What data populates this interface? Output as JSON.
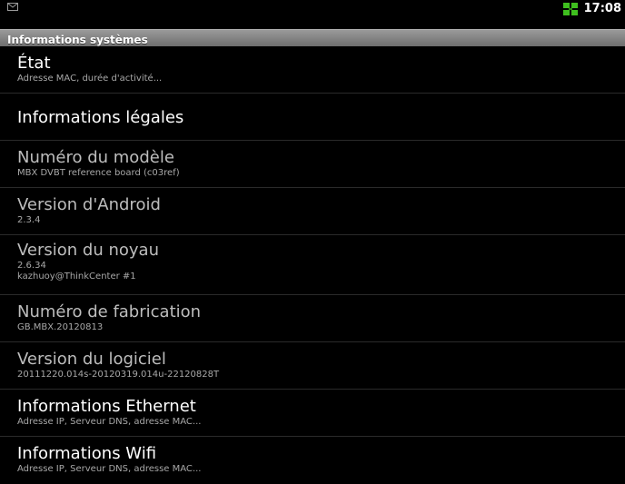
{
  "statusbar": {
    "notification_icon": "mail-icon",
    "network_icon": "network-icon",
    "time": "17:08"
  },
  "title": "Informations systèmes",
  "items": [
    {
      "title": "État",
      "summary": "Adresse MAC, durée d'activité..."
    },
    {
      "title": "Informations légales"
    },
    {
      "title": "Numéro du modèle",
      "summary": "MBX DVBT reference board (c03ref)"
    },
    {
      "title": "Version d'Android",
      "summary": "2.3.4"
    },
    {
      "title": "Version du noyau",
      "summary": "2.6.34",
      "summary2": "kazhuoy@ThinkCenter #1"
    },
    {
      "title": "Numéro de fabrication",
      "summary": "GB.MBX.20120813"
    },
    {
      "title": "Version du logiciel",
      "summary": "20111220.014s-20120319.014u-22120828T"
    },
    {
      "title": "Informations Ethernet",
      "summary": "Adresse IP, Serveur DNS, adresse MAC..."
    },
    {
      "title": "Informations Wifi",
      "summary": "Adresse IP, Serveur DNS, adresse MAC..."
    }
  ],
  "colors": {
    "background": "#000000",
    "title_bar": "#8a8a8a",
    "primary_text": "#ffffff",
    "secondary_text": "#a8a8a8",
    "network_icon": "#44cc22"
  }
}
